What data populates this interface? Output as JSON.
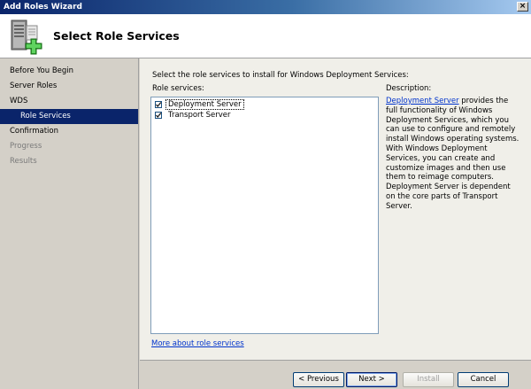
{
  "window": {
    "title": "Add Roles Wizard",
    "close_glyph": "×"
  },
  "header": {
    "title": "Select Role Services",
    "icon": "server-roles-add-icon"
  },
  "sidebar": {
    "items": [
      {
        "label": "Before You Begin",
        "state": "normal"
      },
      {
        "label": "Server Roles",
        "state": "normal"
      },
      {
        "label": "WDS",
        "state": "normal"
      },
      {
        "label": "Role Services",
        "state": "selected"
      },
      {
        "label": "Confirmation",
        "state": "normal"
      },
      {
        "label": "Progress",
        "state": "disabled"
      },
      {
        "label": "Results",
        "state": "disabled"
      }
    ]
  },
  "main": {
    "instruction": "Select the role services to install for Windows Deployment Services:",
    "role_services_label": "Role services:",
    "services": [
      {
        "label": "Deployment Server",
        "checked": true
      },
      {
        "label": "Transport Server",
        "checked": true
      }
    ],
    "description_label": "Description:",
    "description_link": "Deployment Server",
    "description_text": " provides the full functionality of Windows Deployment Services, which you can use to configure and remotely install Windows operating systems. With Windows Deployment Services, you can create and customize images and then use them to reimage computers. Deployment Server is dependent on the core parts of Transport Server.",
    "more_link": "More about role services"
  },
  "buttons": {
    "previous": "< Previous",
    "next": "Next >",
    "install": "Install",
    "cancel": "Cancel"
  },
  "colors": {
    "selection": "#0a246a",
    "link": "#0033cc",
    "title_gradient_start": "#0a246a"
  }
}
